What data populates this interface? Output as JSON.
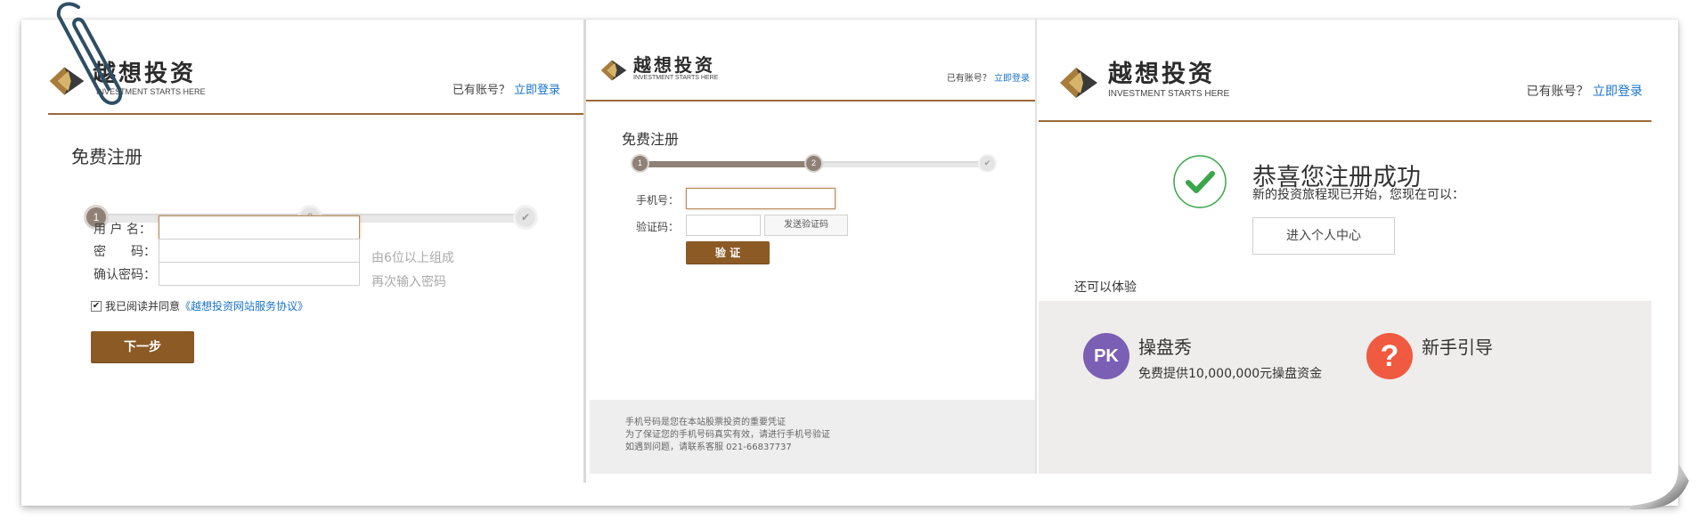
{
  "brand": {
    "name": "越想投资",
    "slogan": "INVESTMENT STARTS HERE"
  },
  "login_prompt": {
    "text": "已有账号？",
    "link": "立即登录"
  },
  "step1": {
    "title": "免费注册",
    "steps": [
      "1",
      "2",
      "✔"
    ],
    "fields": [
      {
        "label": "用 户 名：",
        "value": "",
        "hint": ""
      },
      {
        "label": "密　　码：",
        "value": "",
        "hint": "由6位以上组成"
      },
      {
        "label": "确认密码：",
        "value": "",
        "hint": "再次输入密码"
      }
    ],
    "agree_text": "我已阅读并同意",
    "agree_link": "《越想投资网站服务协议》",
    "agree_checked": true,
    "next_button": "下一步"
  },
  "step2": {
    "title": "免费注册",
    "steps": [
      "1",
      "2",
      "✔"
    ],
    "progress": 0.5,
    "phone_label": "手机号：",
    "phone_value": "",
    "code_label": "验证码：",
    "code_value": "",
    "send_code_button": "发送验证码",
    "verify_button": "验 证",
    "footer_lines": [
      "手机号码是您在本站股票投资的重要凭证",
      "为了保证您的手机号码真实有效，请进行手机号验证",
      "如遇到问题，请联系客服 021-66837737"
    ]
  },
  "step3": {
    "title": "恭喜您注册成功",
    "subtitle": "新的投资旅程现已开始，您现在可以：",
    "center_button": "进入个人中心",
    "also_label": "还可以体验",
    "features": [
      {
        "icon_text": "PK",
        "icon": "pk-icon",
        "name": "操盘秀",
        "desc": "免费提供10,000,000元操盘资金",
        "color": "#7b5fb5"
      },
      {
        "icon_text": "?",
        "icon": "question-icon",
        "name": "新手引导",
        "desc": "",
        "color": "#f05a40"
      }
    ]
  },
  "colors": {
    "brand_brown": "#8b5a25",
    "link_blue": "#1a73c8",
    "step_grey": "#8f8176",
    "success_green": "#3aa54a"
  }
}
